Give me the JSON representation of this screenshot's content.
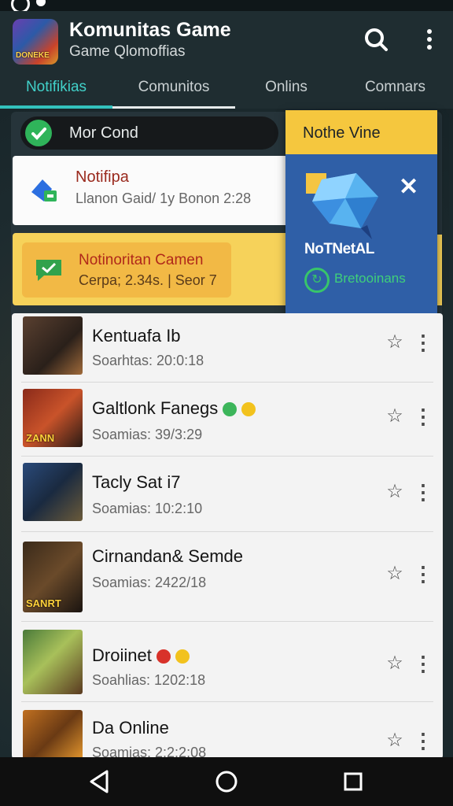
{
  "app": {
    "title": "Komunitas Game",
    "subtitle": "Game Qlomoffias",
    "icon_text": "DONEKE"
  },
  "tabs": [
    {
      "label": "Notifikias",
      "active": true
    },
    {
      "label": "Comunitos",
      "active": false
    },
    {
      "label": "Onlins",
      "active": false
    },
    {
      "label": "Comnars",
      "active": false
    }
  ],
  "header_icons": [
    "search-icon",
    "more-vertical-icon"
  ],
  "chip": {
    "label": "Mor Cond"
  },
  "notice_card": {
    "title": "Notifipa",
    "subtitle": "Llanon Gaid/ 1y Bonon 2:28"
  },
  "alert_card": {
    "title": "Notinoritan Camen",
    "subtitle": "Cerpa; 2.34s. | Seor 7"
  },
  "popup": {
    "title": "Nothe Vine",
    "label": "NoTNetAL",
    "badge": "Bretooinans"
  },
  "games": [
    {
      "title": "Kentuafa Ib",
      "subtitle": "Soarhtas: 20:0:18",
      "thumb_text": ""
    },
    {
      "title": "Galtlonk Fanegs",
      "subtitle": "Soamias: 39/3:29",
      "thumb_text": "ZANN"
    },
    {
      "title": "Tacly Sat i7",
      "subtitle": "Soamias: 10:2:10",
      "thumb_text": ""
    },
    {
      "title": "Cirnandan& Semde",
      "subtitle": "Soamias: 2422/18",
      "thumb_text": "SANRT"
    },
    {
      "title": "Droiinet",
      "subtitle": "Soahlias: 1202:18",
      "thumb_text": ""
    },
    {
      "title": "Da Online",
      "subtitle": "Soamias: 2:2:2:08",
      "thumb_text": ""
    }
  ],
  "colors": {
    "accent": "#33c2bd",
    "header_bg": "#1f2d31",
    "popup_bg": "#2f5fa7",
    "popup_head": "#f5c73e",
    "alert_card": "#f6d25a"
  }
}
